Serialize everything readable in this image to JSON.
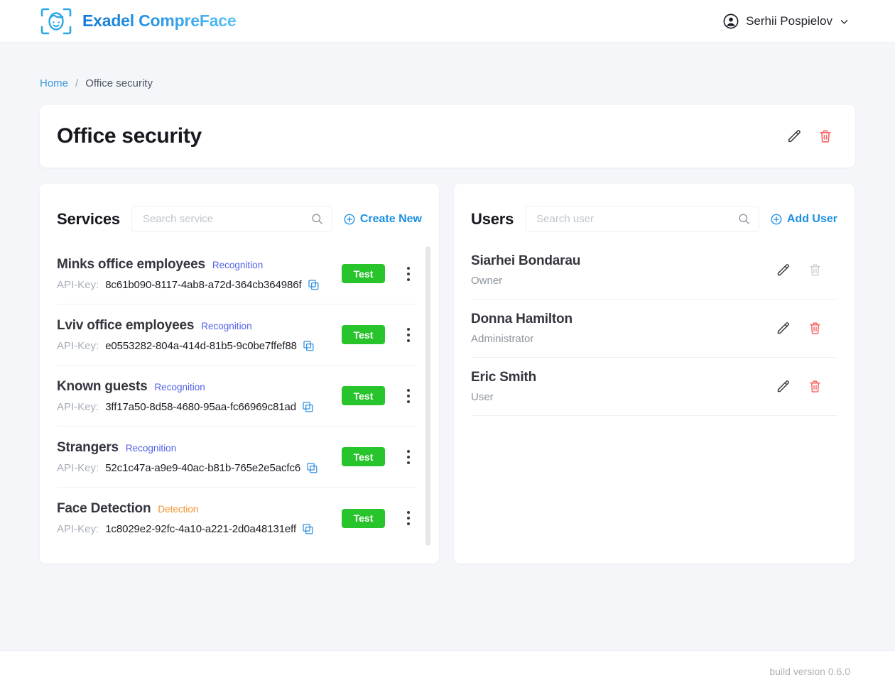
{
  "header": {
    "brand_name": "Exadel CompreFace",
    "logo_icon": "face-scan-icon",
    "user": {
      "name": "Serhii Pospielov",
      "avatar_icon": "account-circle-icon",
      "chevron_icon": "chevron-down-icon"
    }
  },
  "breadcrumb": {
    "home_label": "Home",
    "separator": "/",
    "current_label": "Office security"
  },
  "title_card": {
    "title": "Office security",
    "edit_icon": "pencil-icon",
    "delete_icon": "trash-icon"
  },
  "services_panel": {
    "title": "Services",
    "search_placeholder": "Search service",
    "search_value": "",
    "search_icon": "search-icon",
    "create_label": "Create New",
    "create_icon": "plus-circle-icon",
    "apikey_label": "API-Key:",
    "test_label": "Test",
    "copy_icon": "copy-icon",
    "menu_icon": "more-vertical-icon",
    "items": [
      {
        "name": "Minks office employees",
        "type": "Recognition",
        "type_class": "recognition",
        "api_key": "8c61b090-8117-4ab8-a72d-364cb364986f"
      },
      {
        "name": "Lviv office employees",
        "type": "Recognition",
        "type_class": "recognition",
        "api_key": "e0553282-804a-414d-81b5-9c0be7ffef88"
      },
      {
        "name": "Known guests",
        "type": "Recognition",
        "type_class": "recognition",
        "api_key": "3ff17a50-8d58-4680-95aa-fc66969c81ad"
      },
      {
        "name": "Strangers",
        "type": "Recognition",
        "type_class": "recognition",
        "api_key": "52c1c47a-a9e9-40ac-b81b-765e2e5acfc6"
      },
      {
        "name": "Face Detection",
        "type": "Detection",
        "type_class": "detection",
        "api_key": "1c8029e2-92fc-4a10-a221-2d0a48131eff"
      }
    ]
  },
  "users_panel": {
    "title": "Users",
    "search_placeholder": "Search user",
    "search_value": "",
    "search_icon": "search-icon",
    "add_label": "Add User",
    "add_icon": "plus-circle-icon",
    "edit_icon": "pencil-icon",
    "delete_icon": "trash-icon",
    "items": [
      {
        "name": "Siarhei Bondarau",
        "role": "Owner",
        "delete_enabled": false
      },
      {
        "name": "Donna Hamilton",
        "role": "Administrator",
        "delete_enabled": true
      },
      {
        "name": "Eric Smith",
        "role": "User",
        "delete_enabled": true
      }
    ]
  },
  "footer": {
    "build_version": "build version 0.6.0"
  },
  "colors": {
    "page_background": "#f4f6fa",
    "brand_blue": "#1a8fe3",
    "link_blue": "#3c9ae0",
    "test_green": "#27c42c",
    "delete_red": "#f96a6a",
    "recognition_badge": "#5061e8",
    "detection_badge": "#f2922c"
  }
}
